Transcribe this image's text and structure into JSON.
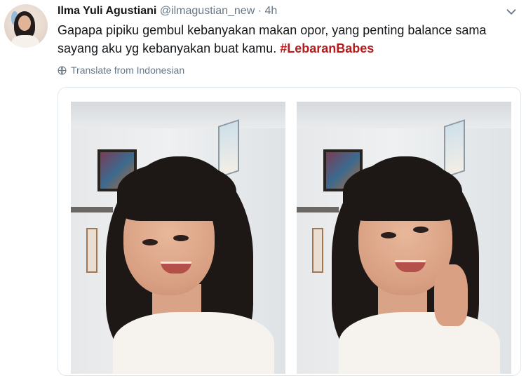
{
  "tweet": {
    "display_name": "Ilma Yuli Agustiani",
    "handle": "@ilmagustian_new",
    "separator": "·",
    "timestamp": "4h",
    "text_main": "Gapapa pipiku gembul kebanyakan makan opor, yang penting balance sama sayang aku yg kebanyakan buat kamu.",
    "hashtag": "#LebaranBabes",
    "translate_label": "Translate from Indonesian"
  },
  "icons": {
    "menu": "chevron-down-icon",
    "translate": "globe-icon"
  },
  "colors": {
    "hashtag": "#b71b1b",
    "secondary_text": "#657786",
    "border": "#e1e8ed"
  }
}
